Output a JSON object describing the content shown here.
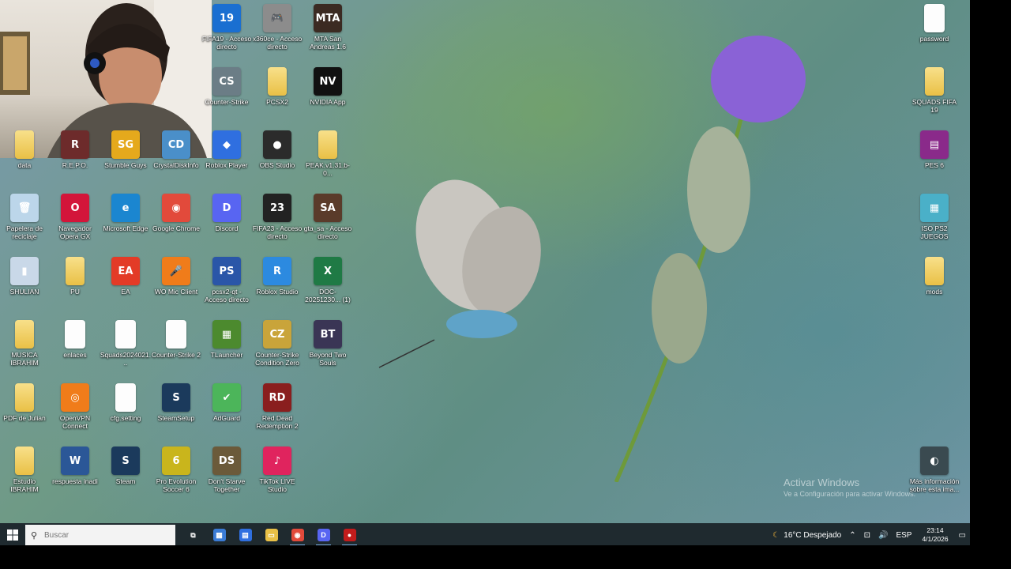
{
  "desktop": {
    "icons": [
      {
        "label": "FIFA19 - Acceso directo",
        "color": "#1a6fd1",
        "glyph": "19",
        "kind": "app"
      },
      {
        "label": "x360ce - Acceso directo",
        "color": "#8c8c8c",
        "glyph": "🎮",
        "kind": "app"
      },
      {
        "label": "MTA San Andreas 1.6",
        "color": "#3b2a22",
        "glyph": "MTA",
        "kind": "app"
      },
      {
        "label": "Counter-Strike",
        "color": "#6b7d86",
        "glyph": "CS",
        "kind": "app"
      },
      {
        "label": "PCSX2",
        "color": "",
        "glyph": "",
        "kind": "folder"
      },
      {
        "label": "NVIDIA App",
        "color": "#111",
        "glyph": "NV",
        "kind": "app"
      },
      {
        "label": "data",
        "color": "",
        "glyph": "",
        "kind": "folder"
      },
      {
        "label": "R.E.P.O.",
        "color": "#6d2b2b",
        "glyph": "R",
        "kind": "app"
      },
      {
        "label": "Stumble Guys",
        "color": "#e5a91c",
        "glyph": "SG",
        "kind": "app"
      },
      {
        "label": "CrystalDiskInfo",
        "color": "#4a8fc9",
        "glyph": "CD",
        "kind": "app"
      },
      {
        "label": "Roblox Player",
        "color": "#2f6fe0",
        "glyph": "◆",
        "kind": "app"
      },
      {
        "label": "OBS Studio",
        "color": "#2b2b2b",
        "glyph": "●",
        "kind": "app"
      },
      {
        "label": "PEAK.v1.31.b-0...",
        "color": "",
        "glyph": "",
        "kind": "folder"
      },
      {
        "label": "Papelera de reciclaje",
        "color": "#bcd6ea",
        "glyph": "🗑",
        "kind": "app"
      },
      {
        "label": "Navegador Opera GX",
        "color": "#d3153a",
        "glyph": "O",
        "kind": "app"
      },
      {
        "label": "Microsoft Edge",
        "color": "#1b86d0",
        "glyph": "e",
        "kind": "app"
      },
      {
        "label": "Google Chrome",
        "color": "#e24a3b",
        "glyph": "◉",
        "kind": "app"
      },
      {
        "label": "Discord",
        "color": "#5865f2",
        "glyph": "D",
        "kind": "app"
      },
      {
        "label": "FIFA23 - Acceso directo",
        "color": "#222",
        "glyph": "23",
        "kind": "app"
      },
      {
        "label": "gta_sa - Acceso directo",
        "color": "#5a3b2a",
        "glyph": "SA",
        "kind": "app"
      },
      {
        "label": "SHULIAN",
        "color": "#c9d8e8",
        "glyph": "▮",
        "kind": "app"
      },
      {
        "label": "PU",
        "color": "",
        "glyph": "",
        "kind": "folder"
      },
      {
        "label": "EA",
        "color": "#e33b27",
        "glyph": "EA",
        "kind": "app"
      },
      {
        "label": "WO Mic Client",
        "color": "#f07c1a",
        "glyph": "🎤",
        "kind": "app"
      },
      {
        "label": "pcsx2-qt - Acceso directo",
        "color": "#2a56a8",
        "glyph": "PS",
        "kind": "app"
      },
      {
        "label": "Roblox Studio",
        "color": "#2c8ae0",
        "glyph": "R",
        "kind": "app"
      },
      {
        "label": "DOC-20251230... (1)",
        "color": "#1f7a45",
        "glyph": "X",
        "kind": "app"
      },
      {
        "label": "MUSICA IBRAHIM",
        "color": "",
        "glyph": "",
        "kind": "folder"
      },
      {
        "label": "enlaces",
        "color": "",
        "glyph": "",
        "kind": "doc"
      },
      {
        "label": "Squads2024021...",
        "color": "",
        "glyph": "",
        "kind": "doc"
      },
      {
        "label": "Counter-Strike 2",
        "color": "",
        "glyph": "",
        "kind": "doc"
      },
      {
        "label": "TLauncher",
        "color": "#4c8a2e",
        "glyph": "▦",
        "kind": "app"
      },
      {
        "label": "Counter-Strike Condition Zero",
        "color": "#c9a43a",
        "glyph": "CZ",
        "kind": "app"
      },
      {
        "label": "Beyond Two Souls",
        "color": "#3a3555",
        "glyph": "BT",
        "kind": "app"
      },
      {
        "label": "PDF de Julian",
        "color": "",
        "glyph": "",
        "kind": "folder"
      },
      {
        "label": "OpenVPN Connect",
        "color": "#f07c1a",
        "glyph": "◎",
        "kind": "app"
      },
      {
        "label": "cfg.setting",
        "color": "",
        "glyph": "",
        "kind": "doc"
      },
      {
        "label": "SteamSetup",
        "color": "#1b3a5c",
        "glyph": "S",
        "kind": "app"
      },
      {
        "label": "AdGuard",
        "color": "#4cb55a",
        "glyph": "✔",
        "kind": "app"
      },
      {
        "label": "Red Dead Redemption 2",
        "color": "#8a1e1e",
        "glyph": "RD",
        "kind": "app"
      },
      {
        "label": "Estudio IBRAHIM",
        "color": "",
        "glyph": "",
        "kind": "folder"
      },
      {
        "label": "respuesta inadi",
        "color": "#2b5797",
        "glyph": "W",
        "kind": "app"
      },
      {
        "label": "Steam",
        "color": "#1b3a5c",
        "glyph": "S",
        "kind": "app"
      },
      {
        "label": "Pro Evolution Soccer 6",
        "color": "#c9b51c",
        "glyph": "6",
        "kind": "app"
      },
      {
        "label": "Don't Starve Together",
        "color": "#6b5a3a",
        "glyph": "DS",
        "kind": "app"
      },
      {
        "label": "TikTok LIVE Studio",
        "color": "#e0245e",
        "glyph": "♪",
        "kind": "app"
      },
      {
        "label": "password",
        "color": "",
        "glyph": "",
        "kind": "doc"
      },
      {
        "label": "SQUADS FIFA 19",
        "color": "",
        "glyph": "",
        "kind": "folder"
      },
      {
        "label": "PES 6",
        "color": "#8a2a8a",
        "glyph": "▤",
        "kind": "app"
      },
      {
        "label": "ISO PS2 JUEGOS",
        "color": "#4ab0c8",
        "glyph": "▦",
        "kind": "app"
      },
      {
        "label": "mods",
        "color": "",
        "glyph": "",
        "kind": "folder"
      },
      {
        "label": "Más información sobre esta ima...",
        "color": "#3a4a50",
        "glyph": "◐",
        "kind": "app"
      }
    ],
    "watermark": {
      "title": "Activar Windows",
      "subtitle": "Ve a Configuración para activar Windows."
    }
  },
  "taskbar": {
    "search_placeholder": "Buscar",
    "apps": [
      {
        "name": "task-view",
        "glyph": "⧉",
        "color": "#1f2a2f"
      },
      {
        "name": "store",
        "glyph": "▦",
        "color": "#3a7bd5"
      },
      {
        "name": "notes",
        "glyph": "▤",
        "color": "#2f6fe0"
      },
      {
        "name": "file-explorer",
        "glyph": "▭",
        "color": "#e9c046"
      },
      {
        "name": "chrome",
        "glyph": "◉",
        "color": "#e24a3b"
      },
      {
        "name": "discord",
        "glyph": "D",
        "color": "#5865f2"
      },
      {
        "name": "recorder",
        "glyph": "●",
        "color": "#c21c1c"
      }
    ],
    "weather": "16°C  Despejado",
    "language": "ESP",
    "time": "23:14",
    "date": "4/1/2026"
  }
}
